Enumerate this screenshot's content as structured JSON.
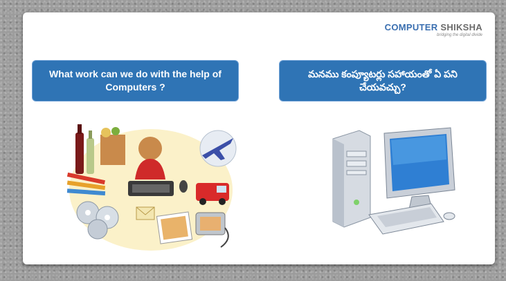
{
  "logo": {
    "word1": "COMPUTER",
    "word2": " SHIKSHA",
    "tagline": "bridging the digital divide"
  },
  "question_english": "What work can we do with the help of Computers ?",
  "question_telugu": "మనము కంప్యూటర్లు సహాయంతో ఏ పని చేయవచ్చు?",
  "illustrations": {
    "left": "computer-uses-icon",
    "right": "desktop-computer-icon"
  }
}
